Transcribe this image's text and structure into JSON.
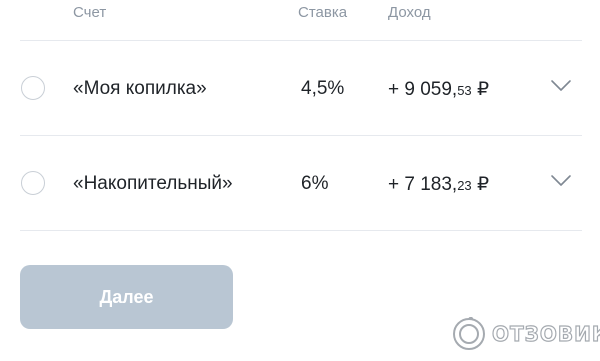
{
  "columns": {
    "account": "Счет",
    "rate": "Ставка",
    "income": "Доход"
  },
  "accounts": [
    {
      "name": "«Моя копилка»",
      "rate": "4,5%",
      "income_main": "+ 9 059,",
      "income_kop": "53",
      "currency": " ₽",
      "selected": false
    },
    {
      "name": "«Накопительный»",
      "rate": "6%",
      "income_main": "+ 7 183,",
      "income_kop": "23",
      "currency": " ₽",
      "selected": false
    }
  ],
  "next_button": {
    "label": "Далее"
  },
  "watermark": {
    "text": "ОТЗОВИК"
  },
  "colors": {
    "header_text": "#8d97a3",
    "button_bg": "#b9c6d3",
    "divider": "#e6e9ee"
  },
  "icons": {
    "row_expand": "chevron-down-icon",
    "radio": "radio-icon"
  }
}
